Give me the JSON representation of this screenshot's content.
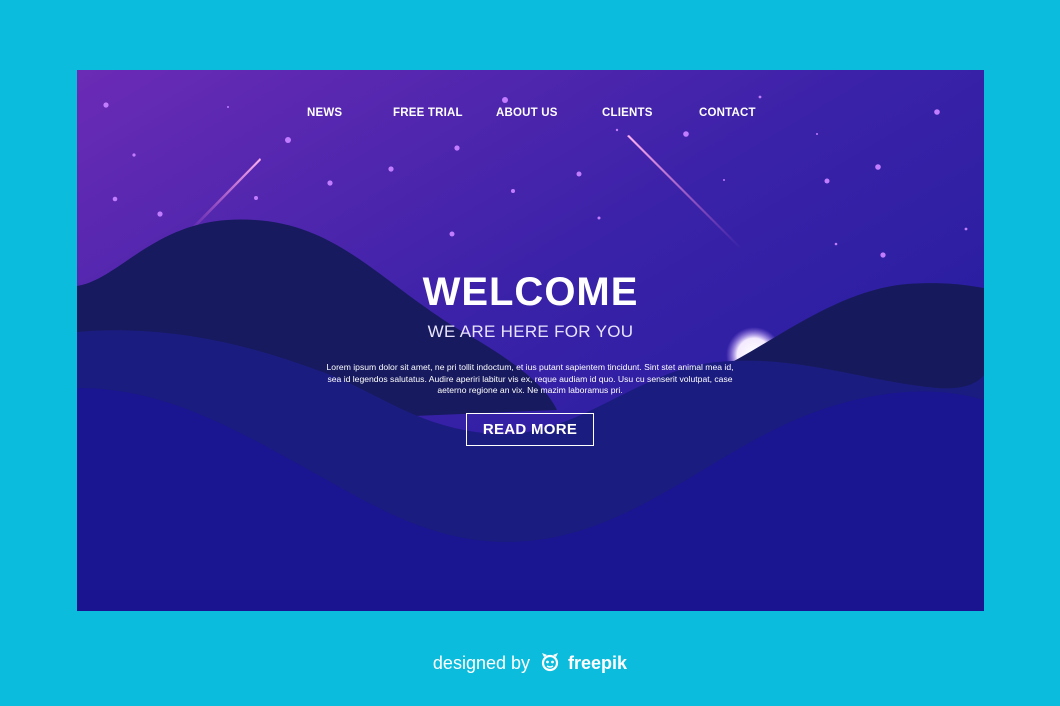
{
  "nav": {
    "items": [
      "NEWS",
      "FREE TRIAL",
      "ABOUT US",
      "CLIENTS",
      "CONTACT"
    ]
  },
  "hero": {
    "title": "WELCOME",
    "subtitle": "WE ARE HERE FOR YOU",
    "body": "Lorem ipsum dolor sit amet, ne pri tollit indoctum, et ius putant sapientem tincidunt. Sint stet animal mea id, sea id legendos salutatus. Audire aperiri labitur vis ex, reque audiam id quo. Usu cu senserit volutpat, case aeterno regione an vix. Ne mazim laboramus pri.",
    "cta_label": "READ MORE"
  },
  "credit": {
    "prefix": "designed by",
    "brand": "freepik"
  },
  "colors": {
    "page_background": "#0cbcdc",
    "sky_top": "#6a2fb8",
    "sky_bottom": "#1f1a9e",
    "dark_hill": "#15185e",
    "mid_hill": "#1a1b7e",
    "front_hill": "#1a1490",
    "text": "#ffffff"
  },
  "icons": {
    "brand_logo": "freepik-logo-icon"
  }
}
